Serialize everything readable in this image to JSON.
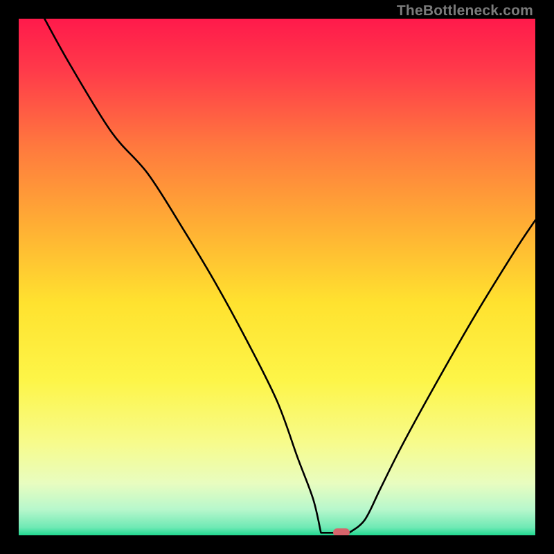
{
  "watermark": "TheBottleneck.com",
  "chart_data": {
    "type": "line",
    "title": "",
    "xlabel": "",
    "ylabel": "",
    "xlim": [
      0,
      100
    ],
    "ylim": [
      0,
      100
    ],
    "grid": false,
    "legend": false,
    "gradient_stops": [
      {
        "offset": 0.0,
        "color": "#ff1a4b"
      },
      {
        "offset": 0.1,
        "color": "#ff3a4a"
      },
      {
        "offset": 0.25,
        "color": "#ff7a3e"
      },
      {
        "offset": 0.4,
        "color": "#ffae34"
      },
      {
        "offset": 0.55,
        "color": "#ffe22f"
      },
      {
        "offset": 0.7,
        "color": "#fdf548"
      },
      {
        "offset": 0.82,
        "color": "#f7fb8b"
      },
      {
        "offset": 0.9,
        "color": "#e8fdc0"
      },
      {
        "offset": 0.95,
        "color": "#b7f7cc"
      },
      {
        "offset": 0.985,
        "color": "#6ee9b4"
      },
      {
        "offset": 1.0,
        "color": "#1fd890"
      }
    ],
    "series": [
      {
        "name": "bottleneck-curve",
        "color": "#000000",
        "x": [
          5,
          10,
          18,
          25,
          32,
          38,
          44,
          50,
          54,
          57,
          59,
          61,
          64,
          67,
          70,
          74,
          80,
          88,
          96,
          100
        ],
        "values": [
          100,
          91,
          78,
          70,
          59,
          49,
          38,
          26,
          15,
          7,
          2,
          0.5,
          0.5,
          3,
          9,
          17,
          28,
          42,
          55,
          61
        ]
      }
    ],
    "marker": {
      "x": 62.5,
      "y": 0.5,
      "color": "#d6646b"
    },
    "flat_bottom": {
      "x_start": 58.5,
      "x_end": 64,
      "y": 0.5
    }
  }
}
